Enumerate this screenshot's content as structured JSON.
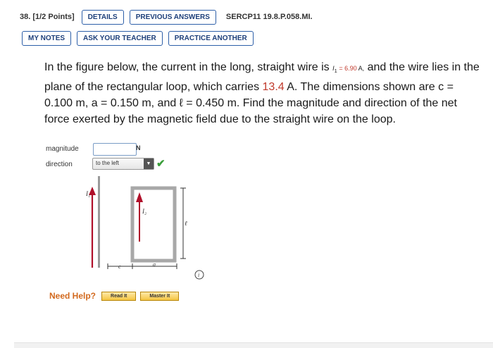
{
  "header": {
    "question_number": "38. [1/2 Points]",
    "details_label": "DETAILS",
    "previous_answers_label": "PREVIOUS ANSWERS",
    "problem_code": "SERCP11 19.8.P.058.MI."
  },
  "toolbar": {
    "my_notes_label": "MY NOTES",
    "ask_teacher_label": "ASK YOUR TEACHER",
    "practice_another_label": "PRACTICE ANOTHER"
  },
  "question": {
    "p1": "In the figure below, the current in the long, straight wire is",
    "i1_symbol": "I",
    "i1_sub": "1",
    "i1_value": "= 6.90",
    "i1_unit": "A,",
    "p2": "and the wire lies in the plane of the rectangular loop, which carries",
    "loop_current": "13.4",
    "p3": "A. The dimensions shown are c = 0.100 m, a = 0.150 m, and ℓ = 0.450 m. Find the magnitude and direction of the net force exerted by the magnetic field due to the straight wire on the loop."
  },
  "answers": {
    "magnitude_label": "magnitude",
    "magnitude_value": "",
    "magnitude_unit": "N",
    "direction_label": "direction",
    "direction_value": "to the left",
    "direction_status": "correct"
  },
  "figure": {
    "label_i1": "I₁",
    "label_i2": "I₂",
    "label_l": "ℓ",
    "label_c": "c",
    "label_a": "a",
    "info_icon": "info-circle-icon"
  },
  "help": {
    "label": "Need Help?",
    "read_it": "Read It",
    "master_it": "Master It"
  },
  "colors": {
    "arrow": "#b0102a",
    "link_blue": "#1d3f7a",
    "check_green": "#3a9e3a"
  }
}
